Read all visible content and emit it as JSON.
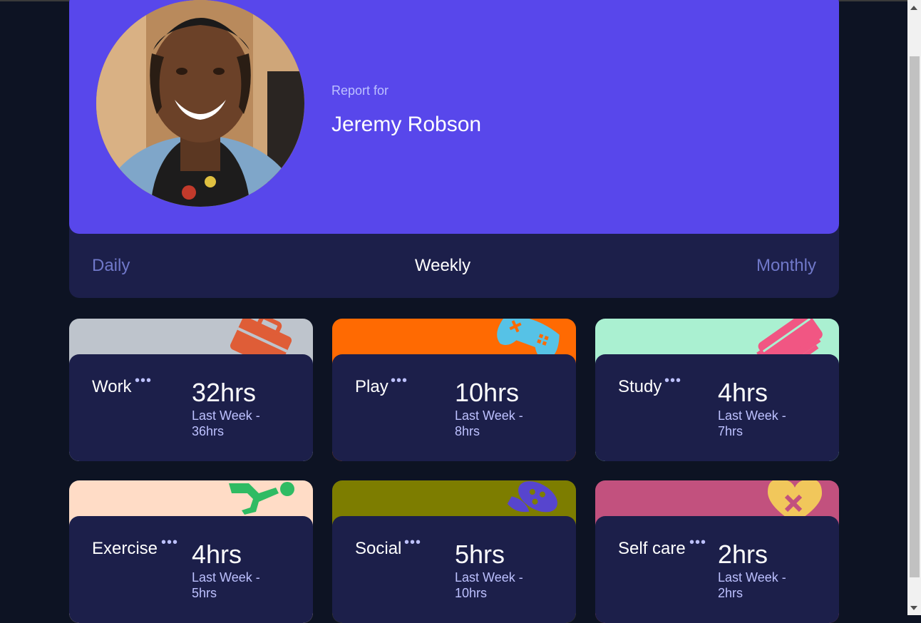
{
  "profile": {
    "report_for": "Report for",
    "name": "Jeremy Robson"
  },
  "tabs": [
    {
      "label": "Daily",
      "active": false
    },
    {
      "label": "Weekly",
      "active": true
    },
    {
      "label": "Monthly",
      "active": false
    }
  ],
  "cards": [
    {
      "title": "Work",
      "current": "32hrs",
      "previous": "Last Week - 36hrs",
      "color": "#bec4cc",
      "icon": "briefcase-icon"
    },
    {
      "title": "Play",
      "current": "10hrs",
      "previous": "Last Week - 8hrs",
      "color": "#ff6a02",
      "icon": "gamepad-icon"
    },
    {
      "title": "Study",
      "current": "4hrs",
      "previous": "Last Week - 7hrs",
      "color": "#aaf0d1",
      "icon": "books-icon"
    },
    {
      "title": "Exercise",
      "current": "4hrs",
      "previous": "Last Week - 5hrs",
      "color": "#ffdcc6",
      "icon": "running-icon"
    },
    {
      "title": "Social",
      "current": "5hrs",
      "previous": "Last Week - 10hrs",
      "color": "#7d7d00",
      "icon": "social-icon"
    },
    {
      "title": "Self care",
      "current": "2hrs",
      "previous": "Last Week - 2hrs",
      "color": "#c2517e",
      "icon": "heart-icon"
    }
  ],
  "ellipsis": "•••"
}
